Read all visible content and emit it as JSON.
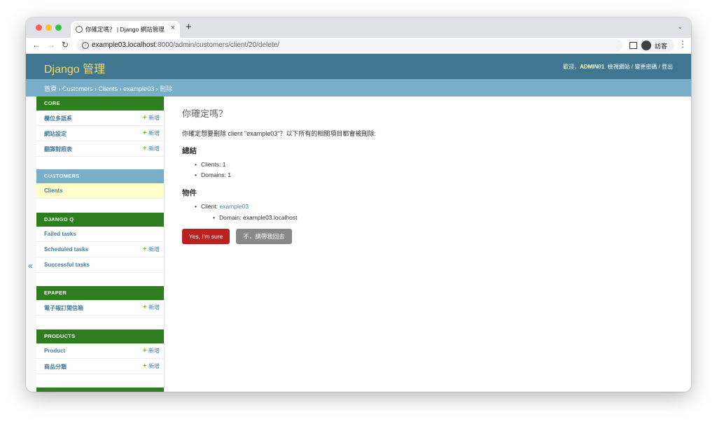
{
  "browser": {
    "tab_title": "你確定嗎？ | Django 網站管理",
    "tab_close": "×",
    "new_tab": "+",
    "tab_search": "⌄",
    "url_host": "example03.localhost",
    "url_rest": ":8000/admin/customers/client/20/delete/",
    "profile_label": "訪客",
    "back": "←",
    "forward": "→",
    "reload": "↻",
    "menu": "⋮"
  },
  "header": {
    "brand": "Django 管理",
    "welcome": "歡迎，",
    "username": "ADMIN01",
    "view_site": "檢視網站",
    "change_password": "變更密碼",
    "logout": "登出",
    "sep": " / "
  },
  "breadcrumbs": {
    "home": "首頁",
    "app": "Customers",
    "model": "Clients",
    "object": "example03",
    "current": "刪除",
    "sep": " › "
  },
  "sidebar": {
    "toggle": "«",
    "add_label": "新增",
    "modules": [
      {
        "caption": "CORE",
        "items": [
          {
            "label": "欄位多語系",
            "add": true
          },
          {
            "label": "網站設定",
            "add": true
          },
          {
            "label": "翻譯對照表",
            "add": true
          }
        ]
      },
      {
        "caption": "CUSTOMERS",
        "items": [
          {
            "label": "Clients",
            "add": false,
            "selected": true
          }
        ]
      },
      {
        "caption": "DJANGO Q",
        "items": [
          {
            "label": "Failed tasks",
            "add": false
          },
          {
            "label": "Scheduled tasks",
            "add": true
          },
          {
            "label": "Successful tasks",
            "add": false
          }
        ]
      },
      {
        "caption": "EPAPER",
        "items": [
          {
            "label": "電子報訂閱信箱",
            "add": true
          }
        ]
      },
      {
        "caption": "PRODUCTS",
        "items": [
          {
            "label": "Product",
            "add": true
          },
          {
            "label": "商品分類",
            "add": true
          }
        ]
      }
    ]
  },
  "content": {
    "title": "你確定嗎？",
    "question": "你確定想要刪除 client \"example03\"？以下所有的相關項目都會被刪除:",
    "summary_heading": "總結",
    "summary": [
      "Clients: 1",
      "Domains: 1"
    ],
    "objects_heading": "物件",
    "object_prefix": "Client: ",
    "object_link": "example03",
    "object_child": "Domain: example03.localhost",
    "confirm_button": "Yes, I'm sure",
    "cancel_button": "不，請帶我回去"
  },
  "colors": {
    "header_bg": "#417690",
    "brand": "#f5dd5d",
    "breadcrumbs_bg": "#79aec8",
    "module_caption_bg": "#2e7d1f",
    "selected_caption_bg": "#79aec8",
    "delete_button": "#ba2121",
    "cancel_button": "#888888",
    "link": "#447e9b"
  }
}
